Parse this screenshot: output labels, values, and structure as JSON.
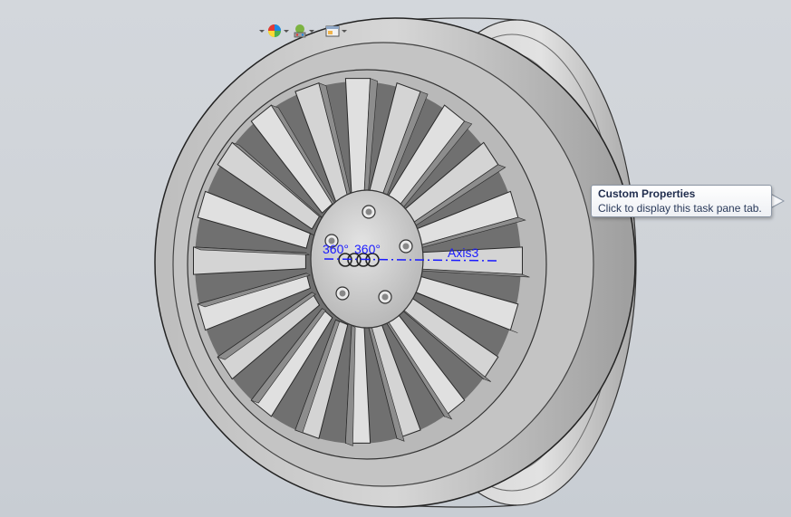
{
  "tooltip": {
    "title": "Custom Properties",
    "body": "Click to display this task pane tab."
  },
  "annotations": {
    "angle1": "360°",
    "angle2": "360°",
    "axis": "Axis3"
  },
  "hud_toolbar": {
    "items": [
      "appearance-sphere-icon",
      "scene-icon",
      "view-settings-icon"
    ]
  },
  "colors": {
    "axis_line": "#1a1aff",
    "background": "#d0d4d9",
    "metal": "#c9c9c9"
  }
}
